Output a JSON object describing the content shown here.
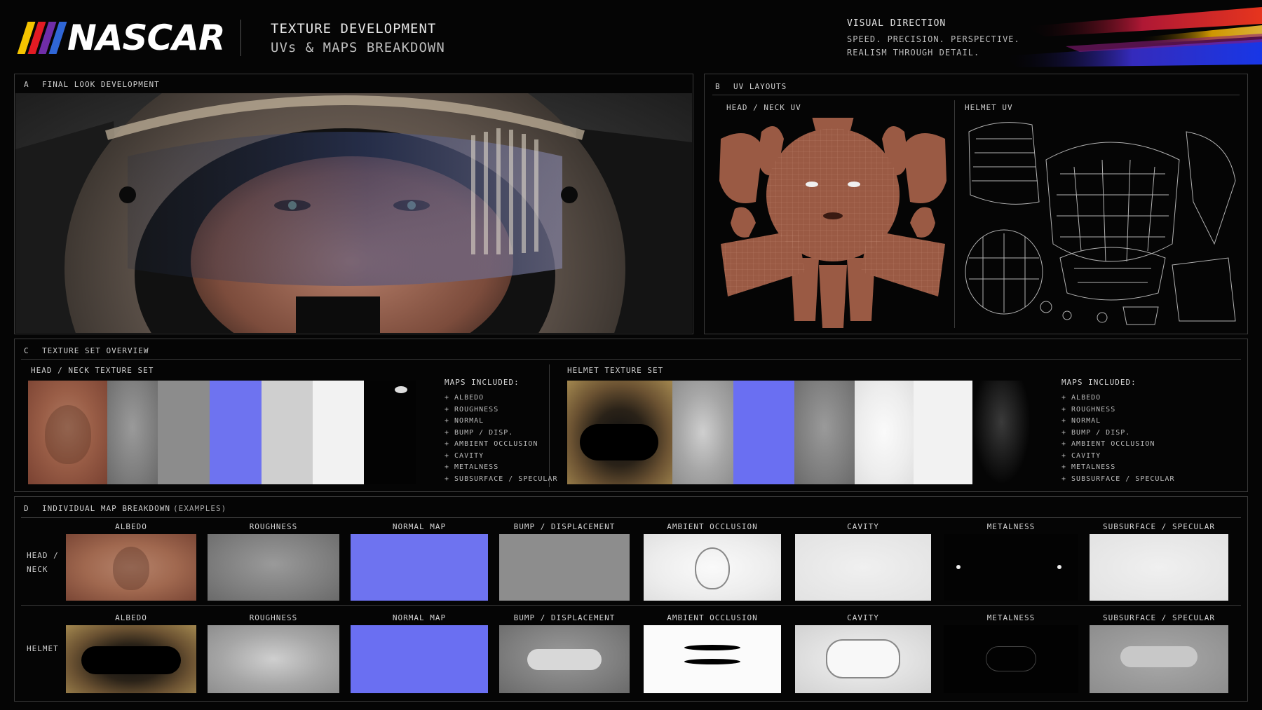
{
  "header": {
    "logo_text": "NASCAR",
    "logo_bar_colors": [
      "#f5c400",
      "#e31b23",
      "#6f2da8",
      "#2f66d6"
    ],
    "title": "TEXTURE DEVELOPMENT",
    "subtitle": "UVs & MAPS BREAKDOWN",
    "visual_direction": {
      "heading": "VISUAL DIRECTION",
      "lines": [
        "SPEED. PRECISION. PERSPECTIVE.",
        "REALISM THROUGH DETAIL."
      ]
    }
  },
  "section_a": {
    "letter": "A",
    "title": "FINAL LOOK DEVELOPMENT"
  },
  "section_b": {
    "letter": "B",
    "title": "UV LAYOUTS",
    "head_label": "HEAD / NECK UV",
    "helmet_label": "HELMET UV"
  },
  "section_c": {
    "letter": "C",
    "title": "TEXTURE SET OVERVIEW",
    "head_set_label": "HEAD / NECK TEXTURE SET",
    "helmet_set_label": "HELMET TEXTURE SET",
    "maps_heading": "MAPS INCLUDED:",
    "maps": [
      "+ ALBEDO",
      "+ ROUGHNESS",
      "+ NORMAL",
      "+ BUMP / DISP.",
      "+ AMBIENT OCCLUSION",
      "+ CAVITY",
      "+ METALNESS",
      "+ SUBSURFACE / SPECULAR"
    ]
  },
  "section_d": {
    "letter": "D",
    "title": "INDIVIDUAL MAP BREAKDOWN",
    "title_suffix": "(EXAMPLES)",
    "columns": [
      "ALBEDO",
      "ROUGHNESS",
      "NORMAL MAP",
      "BUMP / DISPLACEMENT",
      "AMBIENT OCCLUSION",
      "CAVITY",
      "METALNESS",
      "SUBSURFACE / SPECULAR"
    ],
    "row_head_line1": "HEAD /",
    "row_head_line2": "NECK",
    "row_helmet": "HELMET"
  }
}
